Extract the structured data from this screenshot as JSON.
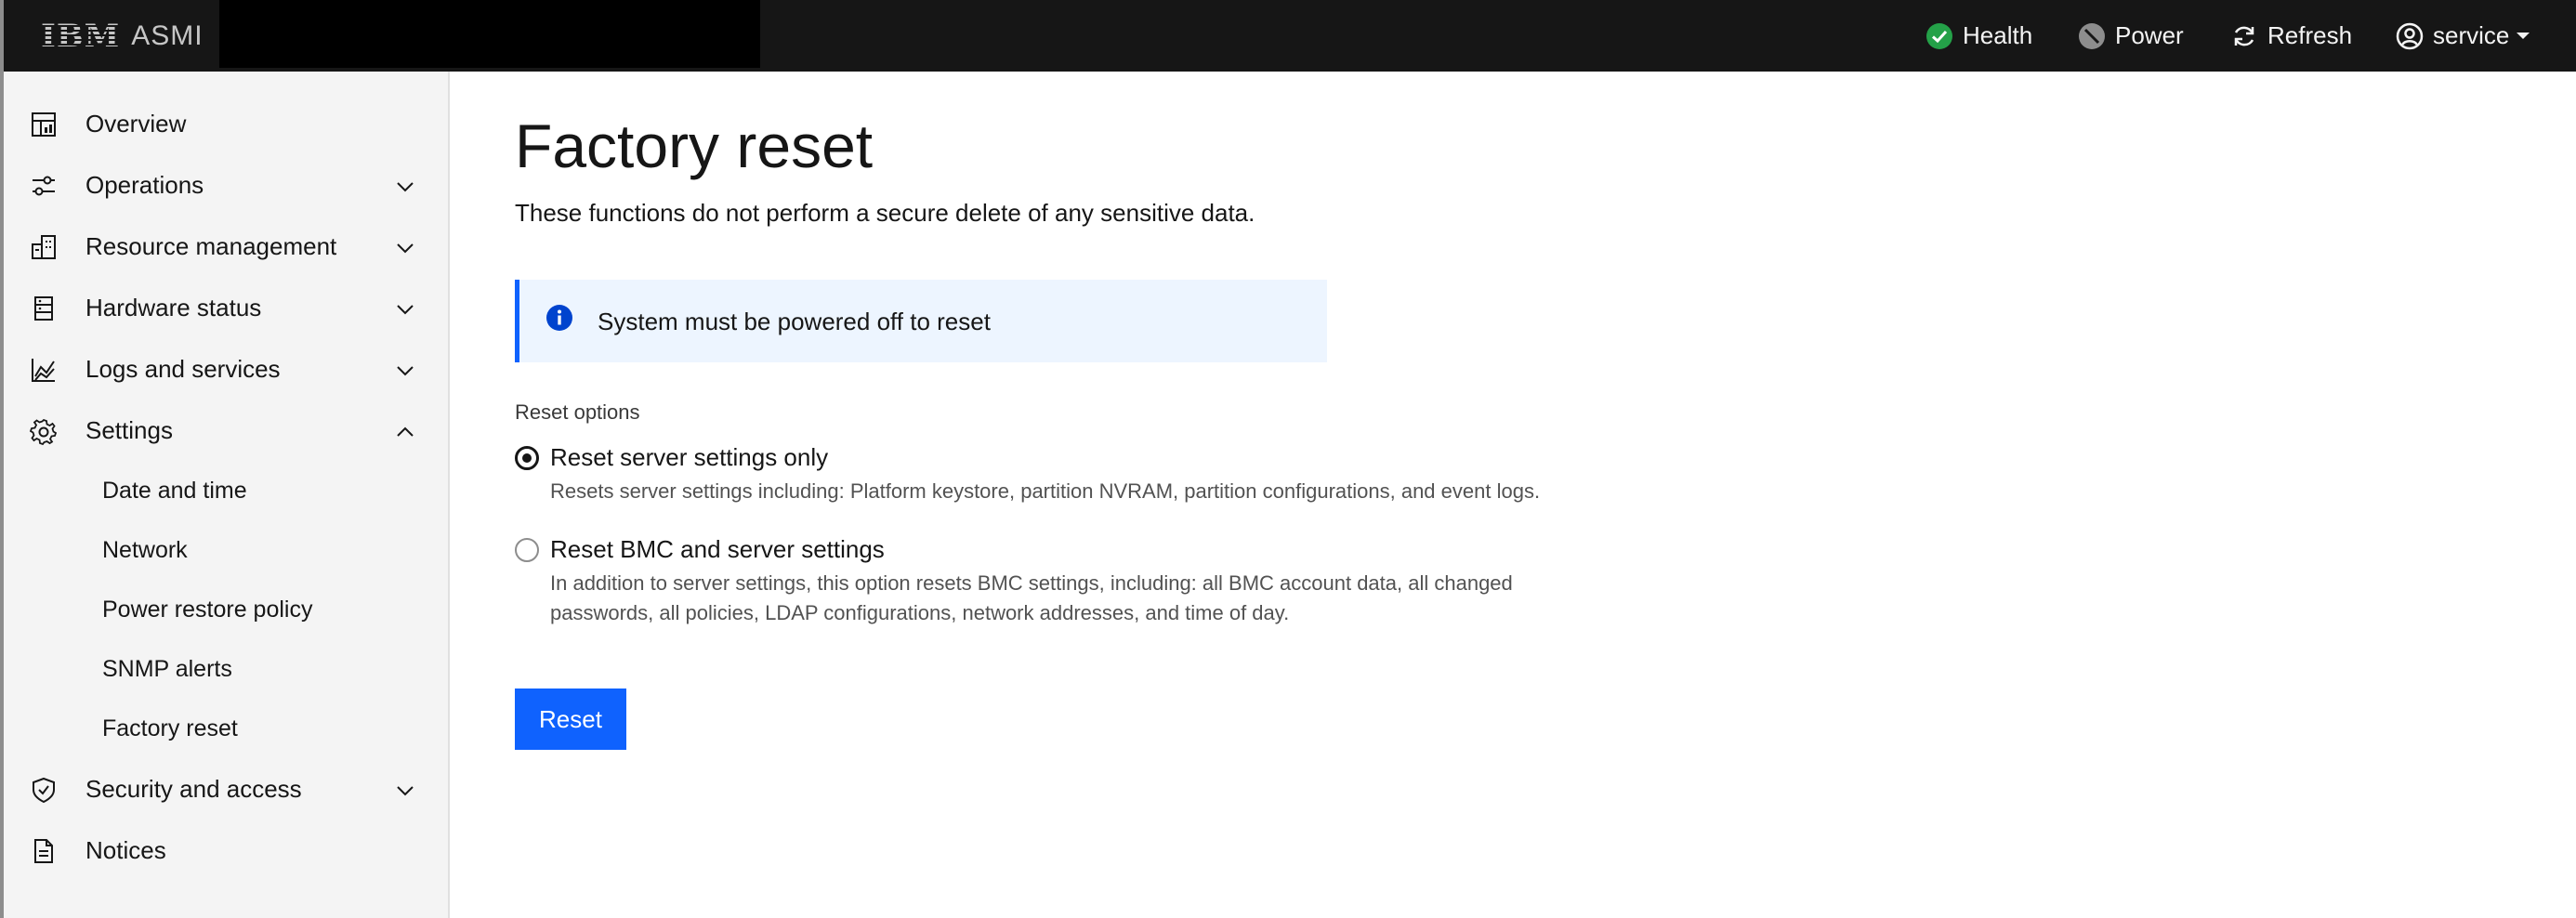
{
  "header": {
    "brand_logo": "IBM",
    "brand_name": "ASMI",
    "actions": {
      "health": "Health",
      "power": "Power",
      "refresh": "Refresh",
      "user": "service"
    },
    "colors": {
      "health_status": "#24a148",
      "background": "#161616"
    }
  },
  "sidebar": {
    "items": [
      {
        "label": "Overview",
        "icon": "dashboard-icon"
      },
      {
        "label": "Operations",
        "icon": "sliders-icon"
      },
      {
        "label": "Resource management",
        "icon": "building-icon"
      },
      {
        "label": "Hardware status",
        "icon": "server-icon"
      },
      {
        "label": "Logs and services",
        "icon": "chart-icon"
      },
      {
        "label": "Settings",
        "icon": "gear-icon"
      },
      {
        "label": "Security and access",
        "icon": "shield-icon"
      },
      {
        "label": "Notices",
        "icon": "document-icon"
      }
    ],
    "settings_sub": [
      "Date and time",
      "Network",
      "Power restore policy",
      "SNMP alerts",
      "Factory reset"
    ]
  },
  "main": {
    "title": "Factory reset",
    "description": "These functions do not perform a secure delete of any sensitive data.",
    "alert": "System must be powered off to reset",
    "reset_options_label": "Reset options",
    "options": [
      {
        "label": "Reset server settings only",
        "description": "Resets server settings including: Platform keystore, partition NVRAM, partition configurations, and event logs.",
        "selected": true
      },
      {
        "label": "Reset BMC and server settings",
        "description_line1": "In addition to server settings, this option resets BMC settings, including: all BMC account data, all changed",
        "description_line2": "passwords, all policies, LDAP configurations, network addresses, and time of day.",
        "selected": false
      }
    ],
    "reset_button": "Reset",
    "accent_color": "#0f62fe"
  }
}
